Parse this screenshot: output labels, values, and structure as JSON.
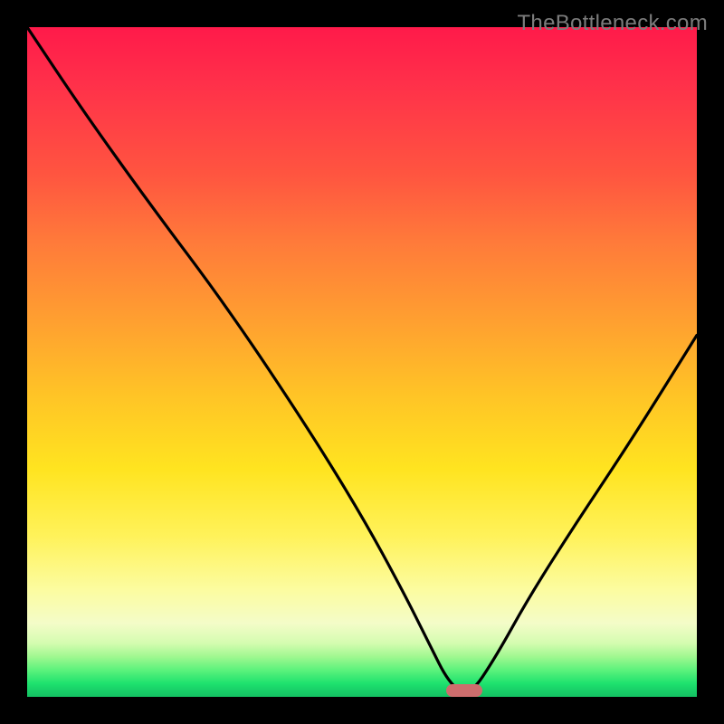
{
  "watermark": "TheBottleneck.com",
  "colors": {
    "frame_bg": "#000000",
    "curve": "#000000",
    "marker": "#cd6d6d",
    "watermark": "#7c7c7c"
  },
  "chart_data": {
    "type": "line",
    "title": "",
    "xlabel": "",
    "ylabel": "",
    "xlim": [
      0,
      100
    ],
    "ylim": [
      0,
      100
    ],
    "grid": false,
    "gradient_stops": [
      {
        "pos": 0,
        "color": "#ff1a4a"
      },
      {
        "pos": 22,
        "color": "#ff5540"
      },
      {
        "pos": 44,
        "color": "#ffa030"
      },
      {
        "pos": 66,
        "color": "#ffe420"
      },
      {
        "pos": 84,
        "color": "#fcfca0"
      },
      {
        "pos": 94,
        "color": "#a0f890"
      },
      {
        "pos": 100,
        "color": "#14c062"
      }
    ],
    "series": [
      {
        "name": "bottleneck-curve",
        "x": [
          0,
          8,
          18,
          30,
          42,
          50,
          56,
          60,
          63,
          66,
          70,
          75,
          82,
          90,
          100
        ],
        "values": [
          100,
          88,
          74,
          58,
          40,
          27,
          16,
          8,
          2,
          0,
          6,
          15,
          26,
          38,
          54
        ]
      }
    ],
    "marker": {
      "x_start": 62.5,
      "x_end": 68.0,
      "y": 0
    }
  }
}
